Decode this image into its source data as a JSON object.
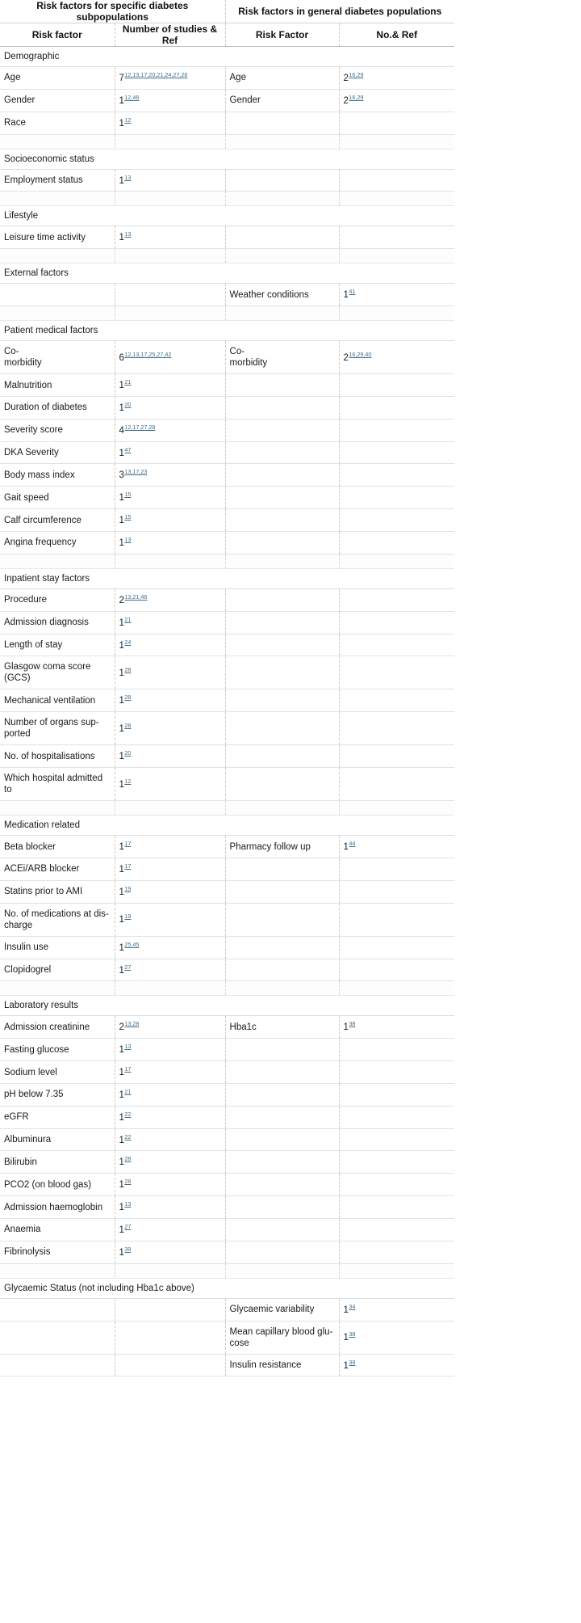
{
  "table": {
    "group_headers": [
      "Risk factors for specific diabetes subpopulations",
      "Risk factors in general diabetes populations"
    ],
    "column_headers": [
      "Risk factor",
      "Number of studies & Ref",
      "Risk Factor",
      "No.& Ref"
    ],
    "sections": [
      {
        "title": "Demographic",
        "left_rows": [
          {
            "factor": "Age",
            "count": "7",
            "refs": "12,13,17,20,21,24,27,28"
          },
          {
            "factor": "Gender",
            "count": "1",
            "refs": "12,46"
          },
          {
            "factor": "Race",
            "count": "1",
            "refs": "12"
          }
        ],
        "right_rows": [
          {
            "factor": "Age",
            "count": "2",
            "refs": "16,29"
          },
          {
            "factor": "Gender",
            "count": "2",
            "refs": "16,29"
          }
        ]
      },
      {
        "title": "Socioeconomic status",
        "left_rows": [
          {
            "factor": "Employment status",
            "count": "1",
            "refs": "13"
          }
        ],
        "right_rows": []
      },
      {
        "title": "Lifestyle",
        "left_rows": [
          {
            "factor": "Leisure time activity",
            "count": "1",
            "refs": "13"
          }
        ],
        "right_rows": []
      },
      {
        "title": "External factors",
        "left_rows": [],
        "right_rows": [
          {
            "factor": "Weather conditions",
            "count": "1",
            "refs": "41"
          }
        ]
      },
      {
        "title": "Patient medical factors",
        "left_rows": [
          {
            "factor": "Co-morbidity",
            "count": "6",
            "refs": "12,13,17,25,27,42"
          },
          {
            "factor": "Malnutrition",
            "count": "1",
            "refs": "21"
          },
          {
            "factor": "Duration of diabetes",
            "count": "1",
            "refs": "20"
          },
          {
            "factor": "Severity score",
            "count": "4",
            "refs": "12,17,27,28"
          },
          {
            "factor": "DKA Severity",
            "count": "1",
            "refs": "47"
          },
          {
            "factor": "Body mass index",
            "count": "3",
            "refs": "13,17,23"
          },
          {
            "factor": "Gait speed",
            "count": "1",
            "refs": "15"
          },
          {
            "factor": "Calf circumference",
            "count": "1",
            "refs": "15"
          },
          {
            "factor": "Angina frequency",
            "count": "1",
            "refs": "13"
          }
        ],
        "right_rows": [
          {
            "factor": "Co-morbidity",
            "count": "2",
            "refs": "16,29,40"
          }
        ]
      },
      {
        "title": "Inpatient stay factors",
        "left_rows": [
          {
            "factor": "Procedure",
            "count": "2",
            "refs": "13,21,46"
          },
          {
            "factor": "Admission diagnosis",
            "count": "1",
            "refs": "21"
          },
          {
            "factor": "Length of stay",
            "count": "1",
            "refs": "24"
          },
          {
            "factor": "Glasgow coma score (GCS)",
            "count": "1",
            "refs": "28"
          },
          {
            "factor": "Mechanical ventilation",
            "count": "1",
            "refs": "28"
          },
          {
            "factor": "Number of organs sup-ported",
            "count": "1",
            "refs": "28"
          },
          {
            "factor": "No. of hospitalisations",
            "count": "1",
            "refs": "20"
          },
          {
            "factor": "Which hospital admitted to",
            "count": "1",
            "refs": "12"
          }
        ],
        "right_rows": []
      },
      {
        "title": "Medication related",
        "left_rows": [
          {
            "factor": "Beta blocker",
            "count": "1",
            "refs": "17"
          },
          {
            "factor": "ACEi/ARB blocker",
            "count": "1",
            "refs": "17"
          },
          {
            "factor": "Statins prior to AMI",
            "count": "1",
            "refs": "19"
          },
          {
            "factor": "No. of medications at dis-charge",
            "count": "1",
            "refs": "19"
          },
          {
            "factor": "Insulin use",
            "count": "1",
            "refs": "25,45"
          },
          {
            "factor": "Clopidogrel",
            "count": "1",
            "refs": "27"
          }
        ],
        "right_rows": [
          {
            "factor": "Pharmacy follow up",
            "count": "1",
            "refs": "44"
          }
        ]
      },
      {
        "title": "Laboratory results",
        "left_rows": [
          {
            "factor": "Admission creatinine",
            "count": "2",
            "refs": "13,28"
          },
          {
            "factor": "Fasting glucose",
            "count": "1",
            "refs": "13"
          },
          {
            "factor": "Sodium level",
            "count": "1",
            "refs": "17"
          },
          {
            "factor": "pH below 7.35",
            "count": "1",
            "refs": "21"
          },
          {
            "factor": "eGFR",
            "count": "1",
            "refs": "22"
          },
          {
            "factor": "Albuminura",
            "count": "1",
            "refs": "22"
          },
          {
            "factor": "Bilirubin",
            "count": "1",
            "refs": "28"
          },
          {
            "factor": "PCO2 (on blood gas)",
            "count": "1",
            "refs": "28"
          },
          {
            "factor": "Admission haemoglobin",
            "count": "1",
            "refs": "13"
          },
          {
            "factor": "Anaemia",
            "count": "1",
            "refs": "27"
          },
          {
            "factor": "Fibrinolysis",
            "count": "1",
            "refs": "39"
          }
        ],
        "right_rows": [
          {
            "factor": "Hba1c",
            "count": "1",
            "refs": "38"
          }
        ]
      },
      {
        "title": "Glycaemic Status (not including Hba1c above)",
        "left_rows": [],
        "right_rows": [
          {
            "factor": "Glycaemic variability",
            "count": "1",
            "refs": "34"
          },
          {
            "factor": "Mean capillary blood glu-cose",
            "count": "1",
            "refs": "38"
          },
          {
            "factor": "Insulin resistance",
            "count": "1",
            "refs": "38"
          }
        ]
      }
    ]
  }
}
